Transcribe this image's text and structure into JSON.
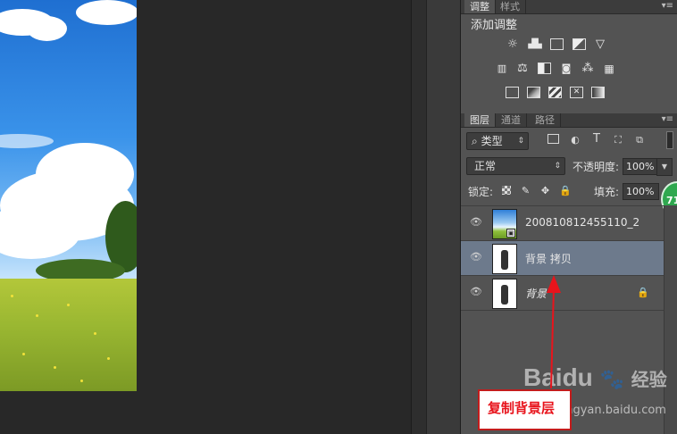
{
  "adjustments_panel": {
    "tabs": [
      "调整",
      "样式"
    ],
    "title": "添加调整",
    "icons_row1": [
      "brightness-icon",
      "levels-icon",
      "curves-icon",
      "exposure-icon",
      "vibrance-icon"
    ],
    "icons_row2": [
      "hue-saturation-icon",
      "color-balance-icon",
      "black-white-icon",
      "photo-filter-icon",
      "channel-mixer-icon",
      "color-lookup-icon"
    ],
    "icons_row3": [
      "invert-icon",
      "posterize-icon",
      "threshold-icon",
      "selective-color-icon",
      "gradient-map-icon"
    ]
  },
  "layers_panel": {
    "tabs": [
      "图层",
      "通道",
      "路径"
    ],
    "filter_kind": "类型",
    "blend_mode": "正常",
    "opacity_label": "不透明度:",
    "opacity_value": "100%",
    "lock_label": "锁定:",
    "fill_label": "填充:",
    "fill_value": "100%",
    "badge": "71",
    "layers": [
      {
        "name": "200810812455110_2",
        "selected": false,
        "locked": false
      },
      {
        "name": "背景 拷贝",
        "selected": true,
        "locked": false
      },
      {
        "name": "背景",
        "selected": false,
        "locked": true
      }
    ]
  },
  "annotation": {
    "label": "复制背景层",
    "color": "#e8141c"
  },
  "watermark": {
    "brand": "Baidu",
    "suffix": "经验",
    "url": "jingyan.baidu.com"
  }
}
